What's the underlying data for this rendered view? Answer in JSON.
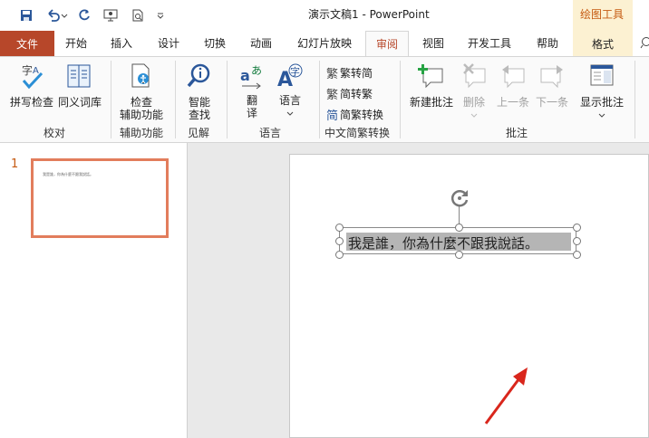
{
  "window": {
    "title": "演示文稿1  -  PowerPoint"
  },
  "context_group": {
    "label": "绘图工具",
    "tab": "格式"
  },
  "tabs": {
    "file": "文件",
    "items": [
      "开始",
      "插入",
      "设计",
      "切换",
      "动画",
      "幻灯片放映",
      "审阅",
      "视图",
      "开发工具",
      "帮助"
    ]
  },
  "ribbon": {
    "proofing": {
      "label": "校对",
      "spell": "拼写检查",
      "thesaurus": "同义词库"
    },
    "accessibility": {
      "label": "辅助功能",
      "check_line1": "检查",
      "check_line2": "辅助功能"
    },
    "insights": {
      "label": "见解",
      "line1": "智能",
      "line2": "查找"
    },
    "language": {
      "label": "语言",
      "translate_line1": "翻",
      "translate_line2": "译",
      "language_btn": "语言"
    },
    "chinese": {
      "label": "中文简繁转换",
      "to_simplified": "繁转简",
      "to_traditional": "简转繁",
      "convert": "简繁转换"
    },
    "comments": {
      "label": "批注",
      "new": "新建批注",
      "delete": "删除",
      "prev": "上一条",
      "next": "下一条",
      "show": "显示批注"
    }
  },
  "slides": {
    "number": "1",
    "thumb_text": "我是誰，你為什麼不跟我說話。"
  },
  "textbox": {
    "text": "我是誰，你為什麼不跟我說話。"
  },
  "colors": {
    "accent": "#b7472a",
    "context": "#fcf1d2",
    "thumb_border": "#e27d5c"
  }
}
